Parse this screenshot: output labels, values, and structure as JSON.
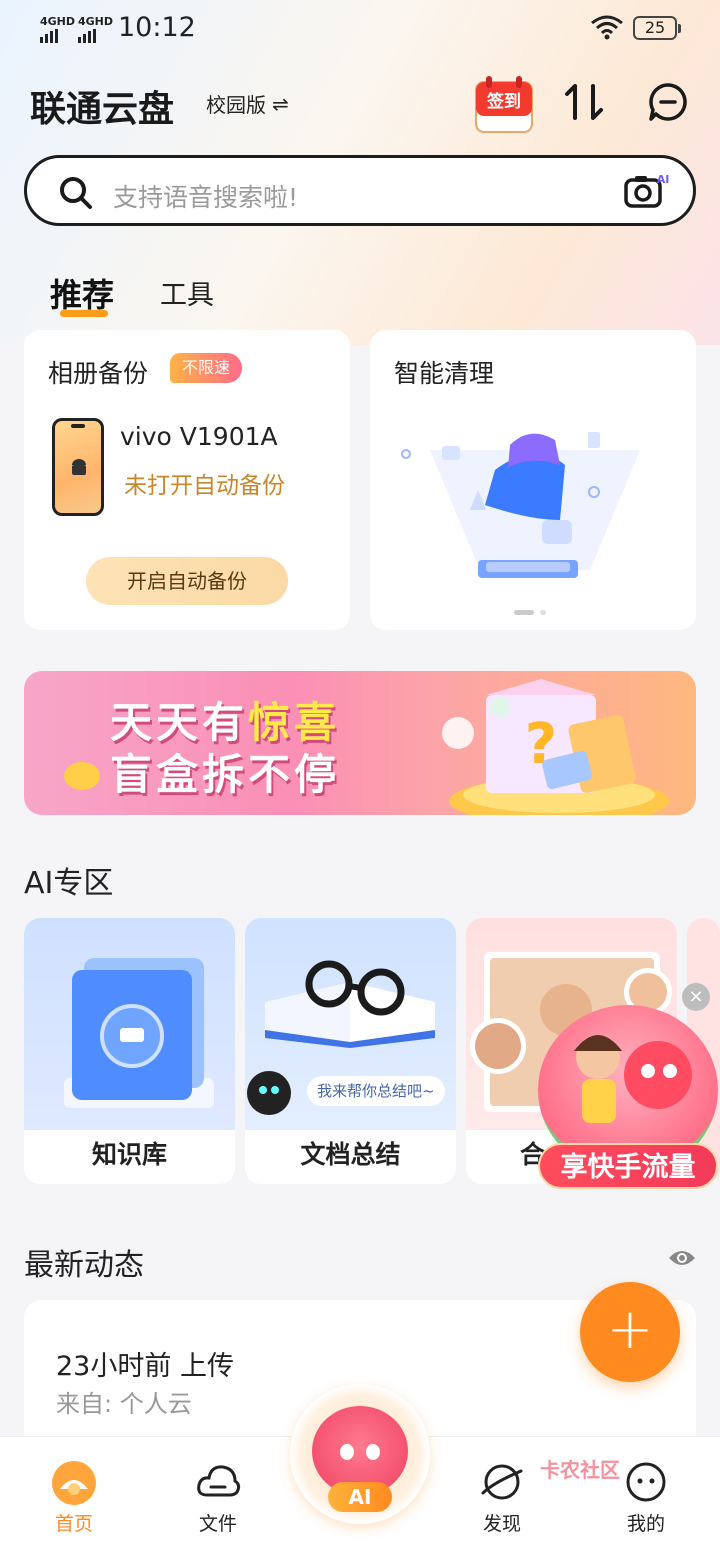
{
  "status_bar": {
    "sim1": "4GHD",
    "sim2": "4GHD",
    "time": "10:12",
    "battery": "25"
  },
  "header": {
    "app_title": "联通云盘",
    "edition": "校园版",
    "edition_switch_icon": "⇌",
    "signin_label": "签到",
    "sort_icon": "transfer-icon",
    "message_icon": "message-icon"
  },
  "search": {
    "placeholder": "支持语音搜索啦!",
    "camera_ai_badge": "AI"
  },
  "tabs": [
    {
      "label": "推荐",
      "active": true
    },
    {
      "label": "工具",
      "active": false
    }
  ],
  "backup_card": {
    "title": "相册备份",
    "badge": "不限速",
    "device_name": "vivo V1901A",
    "status": "未打开自动备份",
    "button": "开启自动备份"
  },
  "clean_card": {
    "title": "智能清理"
  },
  "banner": {
    "line1_prefix": "天天有",
    "line1_highlight": "惊喜",
    "line2": "盲盒拆不停"
  },
  "ai_zone": {
    "title": "AI专区",
    "items": [
      {
        "label": "知识库"
      },
      {
        "label": "文档总结",
        "bubble": "我来帮你总结吧~"
      },
      {
        "label": "合"
      }
    ]
  },
  "float_promo": {
    "label": "享快手流量",
    "close": "×"
  },
  "activity": {
    "title": "最新动态",
    "time_action": "23小时前  上传",
    "source": "来自: 个人云"
  },
  "fab": {
    "label": "+"
  },
  "bottom_nav": [
    {
      "label": "首页",
      "active": true
    },
    {
      "label": "文件",
      "active": false
    },
    {
      "label": "AI",
      "active": false
    },
    {
      "label": "发现",
      "active": false
    },
    {
      "label": "我的",
      "active": false
    }
  ],
  "watermark": "卡农社区",
  "colors": {
    "accent": "#ff8a1f",
    "badge_gradient_start": "#ffb347",
    "badge_gradient_end": "#ff6b8a",
    "backup_status": "#c8862d"
  }
}
